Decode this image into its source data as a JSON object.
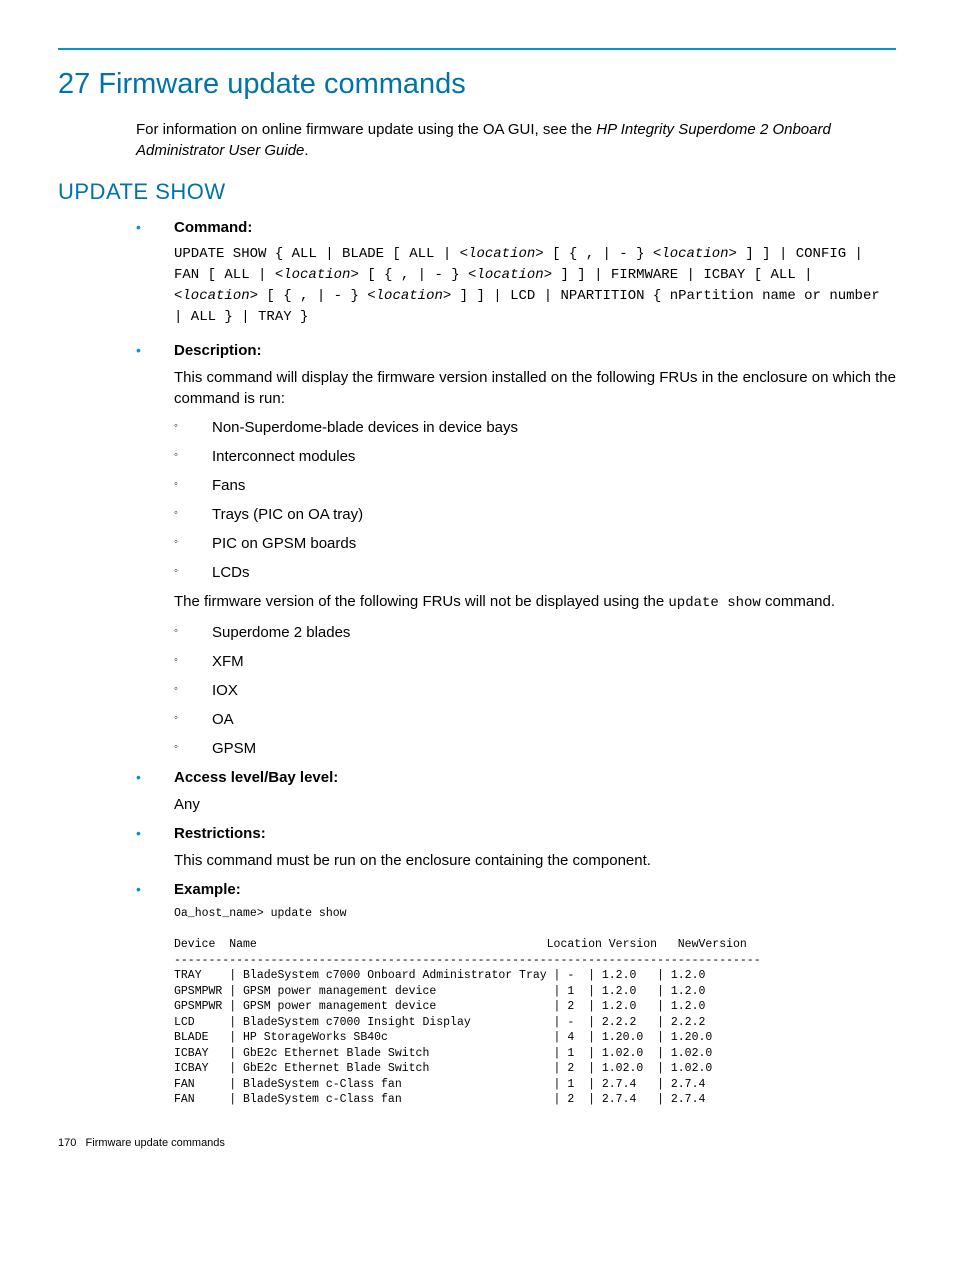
{
  "page_title": "27 Firmware update commands",
  "intro_text": "For information on online firmware update using the OA GUI, see the ",
  "intro_italic": "HP Integrity Superdome 2 Onboard Administrator User Guide",
  "intro_suffix": ".",
  "section_heading": "Update Show",
  "labels": {
    "command": "Command:",
    "description": "Description:",
    "access": "Access level/Bay level:",
    "restrictions": "Restrictions:",
    "example": "Example:"
  },
  "command_code": "UPDATE SHOW { ALL | BLADE [ ALL | <location> [ { , | - } <location> ] ] | CONFIG | FAN [ ALL | <location> [ { , | - } <location> ] ] | FIRMWARE | ICBAY [ ALL | <location> [ { , | - } <location> ] ] | LCD | NPARTITION { nPartition name or number | ALL } | TRAY }",
  "description_intro": "This command will display the firmware version installed on the following FRUs in the enclosure on which the command is run:",
  "list_displayed": [
    "Non-Superdome-blade devices in device bays",
    "Interconnect modules",
    "Fans",
    "Trays (PIC on OA tray)",
    "PIC on GPSM boards",
    "LCDs"
  ],
  "description_mid_a": "The firmware version of the following FRUs will not be displayed using the ",
  "description_mid_code": "update show",
  "description_mid_b": " command.",
  "list_not_displayed": [
    "Superdome 2 blades",
    "XFM",
    "IOX",
    "OA",
    "GPSM"
  ],
  "access_text": "Any",
  "restrictions_text": "This command must be run on the enclosure containing the component.",
  "example_prompt": "Oa_host_name> update show",
  "example_header": "Device  Name                                          Location Version   NewVersion",
  "example_divider": "-------------------------------------------------------------------------------------",
  "example_rows": [
    {
      "device": "TRAY",
      "name": "BladeSystem c7000 Onboard Administrator Tray",
      "location": "-",
      "version": "1.2.0",
      "newversion": "1.2.0"
    },
    {
      "device": "GPSMPWR",
      "name": "GPSM power management device",
      "location": "1",
      "version": "1.2.0",
      "newversion": "1.2.0"
    },
    {
      "device": "GPSMPWR",
      "name": "GPSM power management device",
      "location": "2",
      "version": "1.2.0",
      "newversion": "1.2.0"
    },
    {
      "device": "LCD",
      "name": "BladeSystem c7000 Insight Display",
      "location": "-",
      "version": "2.2.2",
      "newversion": "2.2.2"
    },
    {
      "device": "BLADE",
      "name": "HP StorageWorks SB40c",
      "location": "4",
      "version": "1.20.0",
      "newversion": "1.20.0"
    },
    {
      "device": "ICBAY",
      "name": "GbE2c Ethernet Blade Switch",
      "location": "1",
      "version": "1.02.0",
      "newversion": "1.02.0"
    },
    {
      "device": "ICBAY",
      "name": "GbE2c Ethernet Blade Switch",
      "location": "2",
      "version": "1.02.0",
      "newversion": "1.02.0"
    },
    {
      "device": "FAN",
      "name": "BladeSystem c-Class fan",
      "location": "1",
      "version": "2.7.4",
      "newversion": "2.7.4"
    },
    {
      "device": "FAN",
      "name": "BladeSystem c-Class fan",
      "location": "2",
      "version": "2.7.4",
      "newversion": "2.7.4"
    }
  ],
  "footer_page": "170",
  "footer_text": "Firmware update commands"
}
